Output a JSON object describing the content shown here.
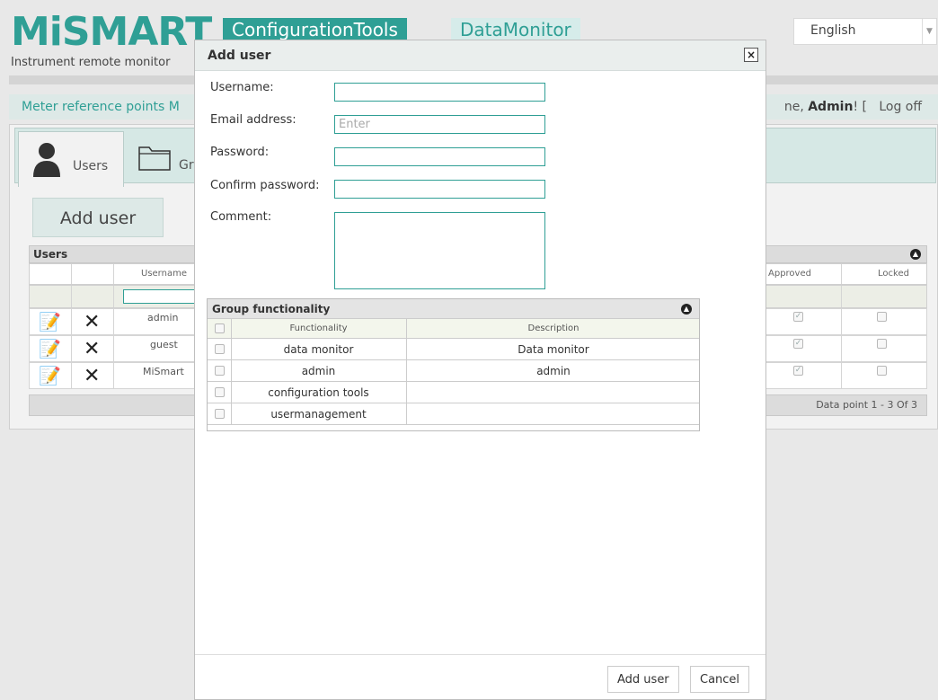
{
  "brand": {
    "logo": "MiSMART",
    "subtitle": "Instrument remote monitor"
  },
  "top_tabs": {
    "config": "ConfigurationTools",
    "monitor": "DataMonitor"
  },
  "language": {
    "selected": "English"
  },
  "nav": {
    "link": "Meter reference points  M",
    "welcome_prefix": "ne, ",
    "welcome_user": "Admin",
    "welcome_suffix": "! [",
    "logoff": "Log off"
  },
  "tabs": {
    "users": "Users",
    "groups": "Gr"
  },
  "main": {
    "add_user_button": "Add user"
  },
  "users_grid": {
    "title": "Users",
    "columns": {
      "username": "Username",
      "approved": "Approved",
      "locked": "Locked"
    },
    "rows": [
      {
        "username": "admin",
        "approved": true,
        "locked": false
      },
      {
        "username": "guest",
        "approved": true,
        "locked": false
      },
      {
        "username": "MiSmart",
        "approved": true,
        "locked": false
      }
    ],
    "pager": "Data point 1 - 3 Of 3"
  },
  "modal": {
    "title": "Add user",
    "close": "×",
    "fields": {
      "username_label": "Username:",
      "username_value": "",
      "email_label": "Email address:",
      "email_placeholder": "Enter",
      "password_label": "Password:",
      "confirm_label": "Confirm password:",
      "comment_label": "Comment:"
    },
    "group_functionality": {
      "title": "Group functionality",
      "columns": {
        "functionality": "Functionality",
        "description": "Description"
      },
      "rows": [
        {
          "functionality": "data monitor",
          "description": "Data monitor"
        },
        {
          "functionality": "admin",
          "description": "admin"
        },
        {
          "functionality": "configuration tools",
          "description": ""
        },
        {
          "functionality": "usermanagement",
          "description": ""
        }
      ]
    },
    "buttons": {
      "add": "Add user",
      "cancel": "Cancel"
    }
  },
  "colors": {
    "accent": "#2f9f95",
    "accent_light": "#d6ecea"
  }
}
